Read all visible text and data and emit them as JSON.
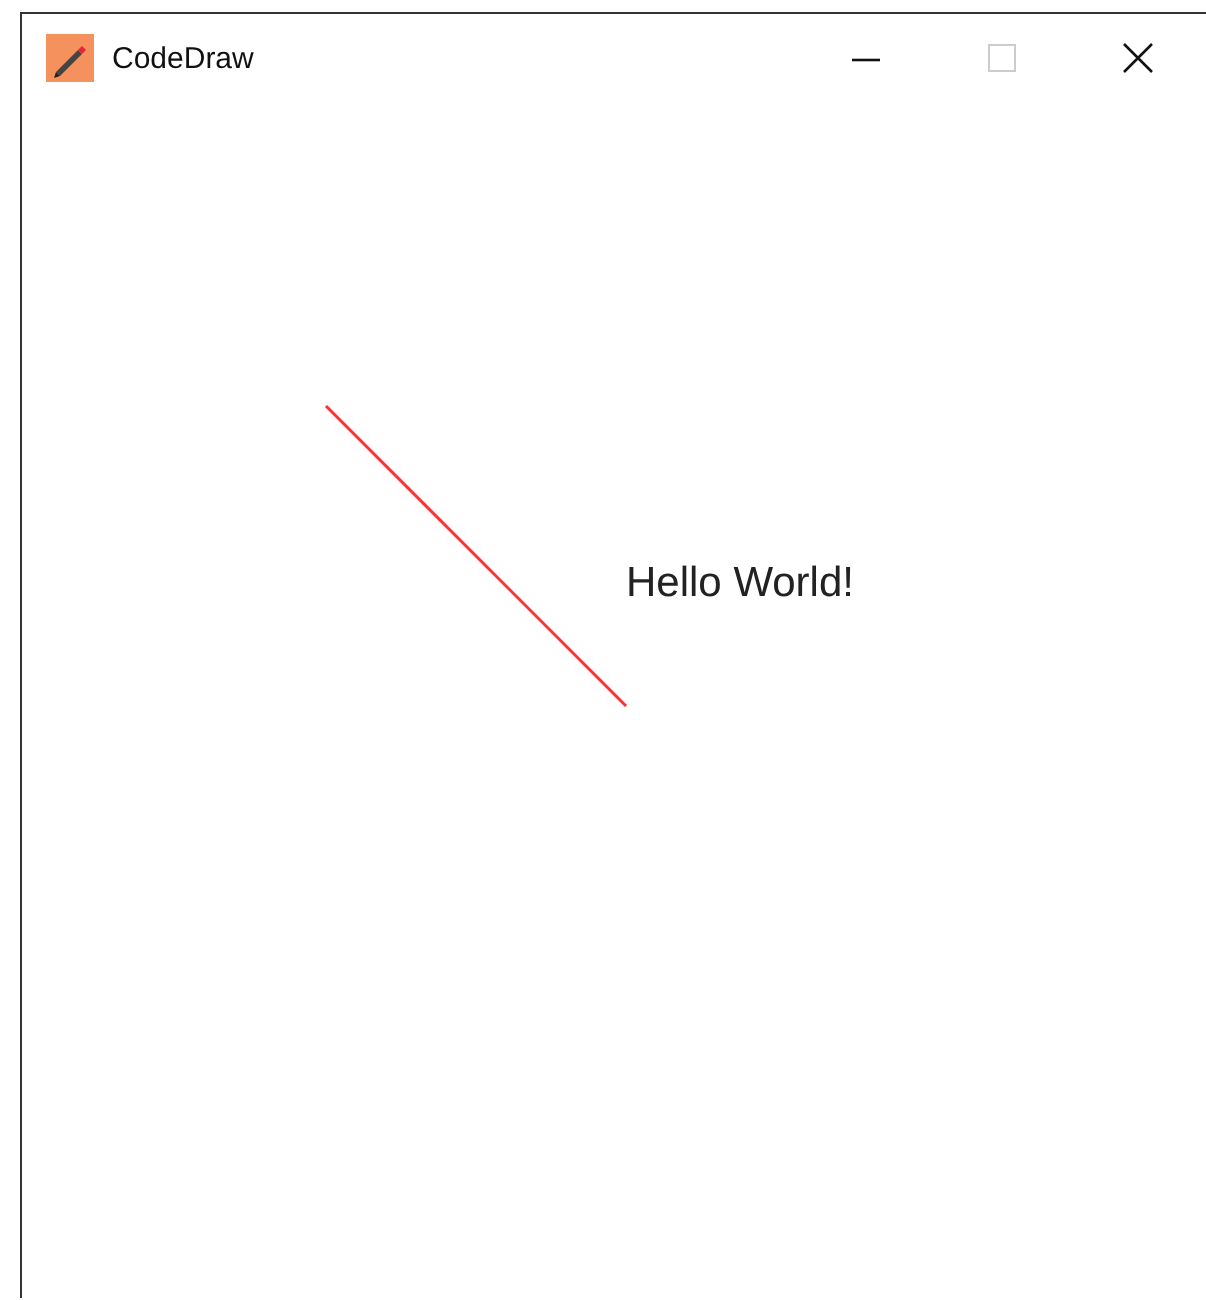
{
  "window": {
    "title": "CodeDraw",
    "controls": [
      {
        "kind": "minimize"
      },
      {
        "kind": "maximize",
        "disabled": true
      },
      {
        "kind": "close"
      }
    ]
  },
  "canvas": {
    "items": [
      {
        "kind": "line"
      },
      {
        "kind": "text",
        "text": "Hello World!"
      }
    ]
  }
}
